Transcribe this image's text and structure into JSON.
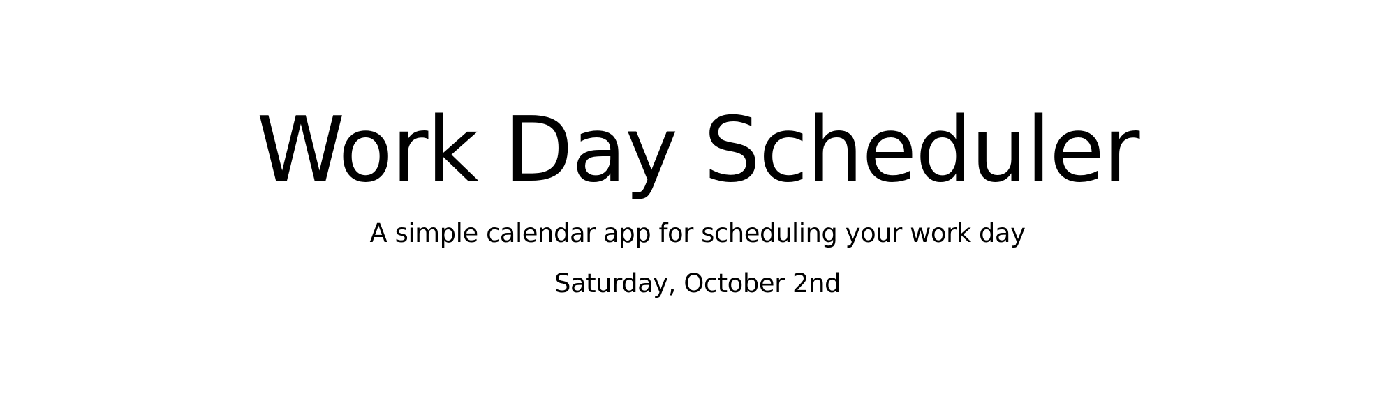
{
  "header": {
    "title": "Work Day Scheduler",
    "subtitle": "A simple calendar app for scheduling your work day",
    "current_day": "Saturday, October 2nd"
  },
  "colors": {
    "background": "#ffffff",
    "text": "#000000"
  }
}
